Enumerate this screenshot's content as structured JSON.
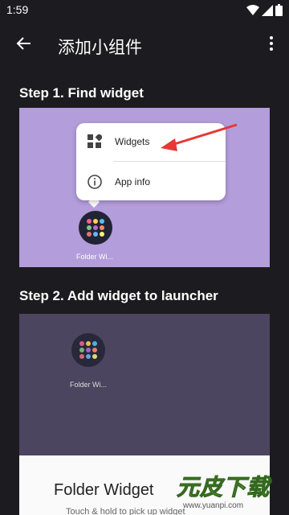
{
  "status_bar": {
    "time": "1:59"
  },
  "toolbar": {
    "title": "添加小组件"
  },
  "steps": [
    {
      "title": "Step 1. Find widget"
    },
    {
      "title": "Step 2. Add widget to launcher"
    }
  ],
  "popup_menu": {
    "items": [
      {
        "label": "Widgets",
        "icon": "widgets-icon"
      },
      {
        "label": "App info",
        "icon": "info-icon"
      }
    ]
  },
  "app": {
    "label": "Folder Wi..."
  },
  "widget_sheet": {
    "title": "Folder Widget",
    "subtitle": "Touch & hold to pick up widget"
  },
  "watermark": {
    "brand": "元皮下载",
    "url": "www.yuanpi.com"
  },
  "colors": {
    "background": "#1c1b1f",
    "step1_panel": "#b39ddb",
    "step2_panel": "#4b4560",
    "arrow": "#e53935",
    "watermark_green": "#8bc34a"
  }
}
